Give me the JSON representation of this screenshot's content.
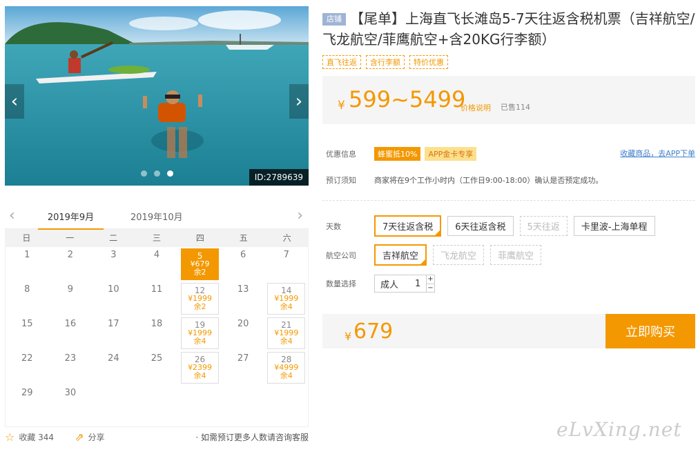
{
  "gallery": {
    "id_tag": "ID:2789639",
    "prev": "‹",
    "next": "›"
  },
  "calendar": {
    "months": [
      "2019年9月",
      "2019年10月"
    ],
    "weekdays": [
      "日",
      "一",
      "二",
      "三",
      "四",
      "五",
      "六"
    ],
    "cells": [
      {
        "d": "1"
      },
      {
        "d": "2"
      },
      {
        "d": "3"
      },
      {
        "d": "4"
      },
      {
        "d": "5",
        "p": "¥679",
        "r": "余2",
        "sel": true
      },
      {
        "d": "6"
      },
      {
        "d": "7"
      },
      {
        "d": "8"
      },
      {
        "d": "9"
      },
      {
        "d": "10"
      },
      {
        "d": "11"
      },
      {
        "d": "12",
        "p": "¥1999",
        "r": "余2"
      },
      {
        "d": "13"
      },
      {
        "d": "14",
        "p": "¥1999",
        "r": "余4"
      },
      {
        "d": "15"
      },
      {
        "d": "16"
      },
      {
        "d": "17"
      },
      {
        "d": "18"
      },
      {
        "d": "19",
        "p": "¥1999",
        "r": "余4"
      },
      {
        "d": "20"
      },
      {
        "d": "21",
        "p": "¥1999",
        "r": "余4"
      },
      {
        "d": "22"
      },
      {
        "d": "23"
      },
      {
        "d": "24"
      },
      {
        "d": "25"
      },
      {
        "d": "26",
        "p": "¥2399",
        "r": "余4"
      },
      {
        "d": "27"
      },
      {
        "d": "28",
        "p": "¥4999",
        "r": "余4"
      },
      {
        "d": "29"
      },
      {
        "d": "30"
      }
    ]
  },
  "footer": {
    "fav_label": "收藏 344",
    "share_label": "分享",
    "note": "· 如需预订更多人数请咨询客服"
  },
  "product": {
    "shop_badge": "店铺",
    "title": "【尾单】上海直飞长滩岛5-7天往返含税机票（吉祥航空/飞龙航空/菲鹰航空+含20KG行李额）",
    "tags": [
      "直飞往返",
      "含行李额",
      "特价优惠"
    ],
    "currency": "¥",
    "price_range": "599~5499",
    "price_note": "价格说明",
    "sold": "已售114"
  },
  "promo": {
    "label": "优惠信息",
    "bee": "蜂蜜抵10%",
    "app": "APP金卡专享",
    "fav_link": "收藏商品，去APP下单"
  },
  "booking": {
    "label": "预订须知",
    "text": "商家将在9个工作小时内（工作日9:00-18:00）确认是否预定成功。"
  },
  "options": {
    "days_label": "天数",
    "days": [
      {
        "t": "7天往返含税",
        "s": "on"
      },
      {
        "t": "6天往返含税",
        "s": ""
      },
      {
        "t": "5天往返",
        "s": "dis"
      },
      {
        "t": "卡里波-上海单程",
        "s": ""
      }
    ],
    "airline_label": "航空公司",
    "airlines": [
      {
        "t": "吉祥航空",
        "s": "on"
      },
      {
        "t": "飞龙航空",
        "s": "dis"
      },
      {
        "t": "菲鹰航空",
        "s": "dis"
      }
    ],
    "qty_label": "数量选择",
    "qty_who": "成人",
    "qty_value": "1",
    "qty_plus": "+",
    "qty_minus": "−"
  },
  "buy": {
    "currency": "¥",
    "price": "679",
    "button": "立即购买"
  },
  "watermark": "eLvXing.net",
  "colors": {
    "accent": "#f39800",
    "link": "#3e7ecb"
  }
}
